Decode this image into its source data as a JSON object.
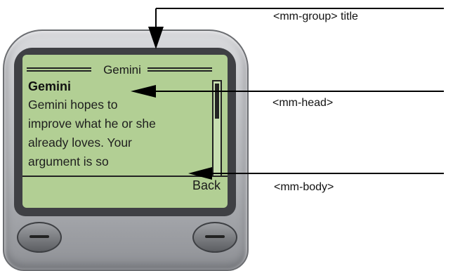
{
  "screen": {
    "group_title": "Gemini",
    "head": "Gemini",
    "body": "Gemini hopes to\nimprove what he or she\nalready loves. Your\nargument is so",
    "softkey": "Back"
  },
  "annotations": {
    "group_title": "<mm-group> title",
    "head": "<mm-head>",
    "body": "<mm-body>"
  },
  "colors": {
    "lcd_background": "#b2cf94",
    "phone_body": "#c3c5c9",
    "text": "#111111"
  }
}
